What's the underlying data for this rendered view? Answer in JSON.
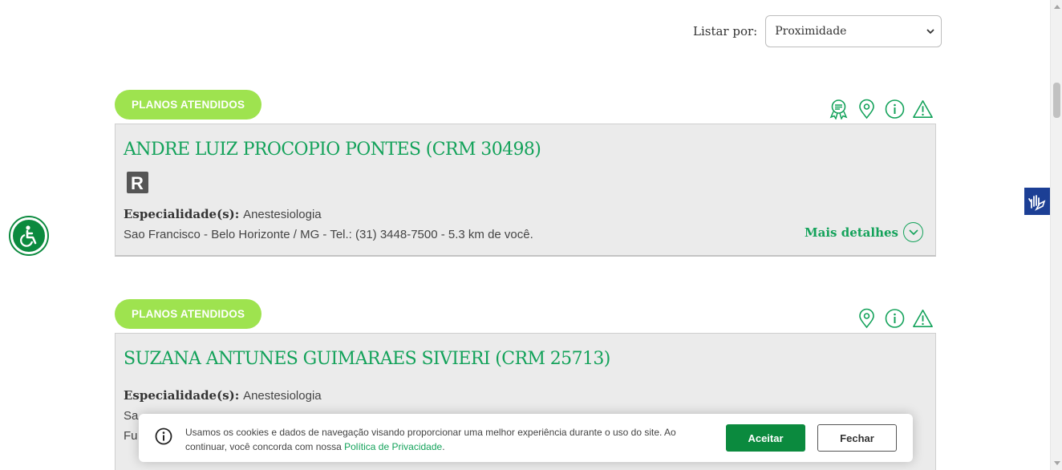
{
  "sort": {
    "label": "Listar por:",
    "selected": "Proximidade"
  },
  "doctors": [
    {
      "plans_label": "PLANOS ATENDIDOS",
      "name": "ANDRE LUIZ PROCOPIO PONTES (CRM 30498)",
      "badge": "R",
      "specialty_label": "Especialidade(s):",
      "specialty": "Anestesiologia",
      "address": "Sao Francisco - Belo Horizonte / MG - Tel.: (31) 3448-7500 - 5.3 km de você.",
      "details_label": "Mais detalhes",
      "icons": [
        "award-icon",
        "map-pin-icon",
        "info-icon",
        "warning-icon"
      ]
    },
    {
      "plans_label": "PLANOS ATENDIDOS",
      "name": "SUZANA ANTUNES GUIMARAES SIVIERI (CRM 25713)",
      "specialty_label": "Especialidade(s):",
      "specialty": "Anestesiologia",
      "address_partial_1": "Sa",
      "address_partial_2": "Fu",
      "icons": [
        "map-pin-icon",
        "info-icon",
        "warning-icon"
      ]
    }
  ],
  "cookie": {
    "text_line1": "Usamos os cookies e dados de navegação visando proporcionar uma melhor experiência durante o uso do site. Ao",
    "text_line2_prefix": "continuar, você concorda com nossa ",
    "link": "Política de Privacidade",
    "text_line2_suffix": ".",
    "accept": "Aceitar",
    "close": "Fechar"
  },
  "colors": {
    "brand_green": "#13a25a",
    "pill_green": "#9ee34f",
    "button_green": "#0b8a3e",
    "libras_blue": "#1c3f95"
  }
}
